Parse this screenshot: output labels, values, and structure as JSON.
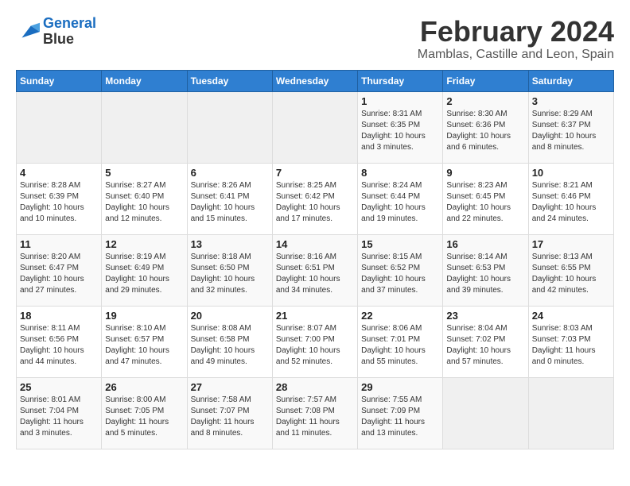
{
  "logo": {
    "line1": "General",
    "line2": "Blue"
  },
  "title": "February 2024",
  "location": "Mamblas, Castille and Leon, Spain",
  "days_of_week": [
    "Sunday",
    "Monday",
    "Tuesday",
    "Wednesday",
    "Thursday",
    "Friday",
    "Saturday"
  ],
  "weeks": [
    [
      {
        "num": "",
        "info": ""
      },
      {
        "num": "",
        "info": ""
      },
      {
        "num": "",
        "info": ""
      },
      {
        "num": "",
        "info": ""
      },
      {
        "num": "1",
        "info": "Sunrise: 8:31 AM\nSunset: 6:35 PM\nDaylight: 10 hours\nand 3 minutes."
      },
      {
        "num": "2",
        "info": "Sunrise: 8:30 AM\nSunset: 6:36 PM\nDaylight: 10 hours\nand 6 minutes."
      },
      {
        "num": "3",
        "info": "Sunrise: 8:29 AM\nSunset: 6:37 PM\nDaylight: 10 hours\nand 8 minutes."
      }
    ],
    [
      {
        "num": "4",
        "info": "Sunrise: 8:28 AM\nSunset: 6:39 PM\nDaylight: 10 hours\nand 10 minutes."
      },
      {
        "num": "5",
        "info": "Sunrise: 8:27 AM\nSunset: 6:40 PM\nDaylight: 10 hours\nand 12 minutes."
      },
      {
        "num": "6",
        "info": "Sunrise: 8:26 AM\nSunset: 6:41 PM\nDaylight: 10 hours\nand 15 minutes."
      },
      {
        "num": "7",
        "info": "Sunrise: 8:25 AM\nSunset: 6:42 PM\nDaylight: 10 hours\nand 17 minutes."
      },
      {
        "num": "8",
        "info": "Sunrise: 8:24 AM\nSunset: 6:44 PM\nDaylight: 10 hours\nand 19 minutes."
      },
      {
        "num": "9",
        "info": "Sunrise: 8:23 AM\nSunset: 6:45 PM\nDaylight: 10 hours\nand 22 minutes."
      },
      {
        "num": "10",
        "info": "Sunrise: 8:21 AM\nSunset: 6:46 PM\nDaylight: 10 hours\nand 24 minutes."
      }
    ],
    [
      {
        "num": "11",
        "info": "Sunrise: 8:20 AM\nSunset: 6:47 PM\nDaylight: 10 hours\nand 27 minutes."
      },
      {
        "num": "12",
        "info": "Sunrise: 8:19 AM\nSunset: 6:49 PM\nDaylight: 10 hours\nand 29 minutes."
      },
      {
        "num": "13",
        "info": "Sunrise: 8:18 AM\nSunset: 6:50 PM\nDaylight: 10 hours\nand 32 minutes."
      },
      {
        "num": "14",
        "info": "Sunrise: 8:16 AM\nSunset: 6:51 PM\nDaylight: 10 hours\nand 34 minutes."
      },
      {
        "num": "15",
        "info": "Sunrise: 8:15 AM\nSunset: 6:52 PM\nDaylight: 10 hours\nand 37 minutes."
      },
      {
        "num": "16",
        "info": "Sunrise: 8:14 AM\nSunset: 6:53 PM\nDaylight: 10 hours\nand 39 minutes."
      },
      {
        "num": "17",
        "info": "Sunrise: 8:13 AM\nSunset: 6:55 PM\nDaylight: 10 hours\nand 42 minutes."
      }
    ],
    [
      {
        "num": "18",
        "info": "Sunrise: 8:11 AM\nSunset: 6:56 PM\nDaylight: 10 hours\nand 44 minutes."
      },
      {
        "num": "19",
        "info": "Sunrise: 8:10 AM\nSunset: 6:57 PM\nDaylight: 10 hours\nand 47 minutes."
      },
      {
        "num": "20",
        "info": "Sunrise: 8:08 AM\nSunset: 6:58 PM\nDaylight: 10 hours\nand 49 minutes."
      },
      {
        "num": "21",
        "info": "Sunrise: 8:07 AM\nSunset: 7:00 PM\nDaylight: 10 hours\nand 52 minutes."
      },
      {
        "num": "22",
        "info": "Sunrise: 8:06 AM\nSunset: 7:01 PM\nDaylight: 10 hours\nand 55 minutes."
      },
      {
        "num": "23",
        "info": "Sunrise: 8:04 AM\nSunset: 7:02 PM\nDaylight: 10 hours\nand 57 minutes."
      },
      {
        "num": "24",
        "info": "Sunrise: 8:03 AM\nSunset: 7:03 PM\nDaylight: 11 hours\nand 0 minutes."
      }
    ],
    [
      {
        "num": "25",
        "info": "Sunrise: 8:01 AM\nSunset: 7:04 PM\nDaylight: 11 hours\nand 3 minutes."
      },
      {
        "num": "26",
        "info": "Sunrise: 8:00 AM\nSunset: 7:05 PM\nDaylight: 11 hours\nand 5 minutes."
      },
      {
        "num": "27",
        "info": "Sunrise: 7:58 AM\nSunset: 7:07 PM\nDaylight: 11 hours\nand 8 minutes."
      },
      {
        "num": "28",
        "info": "Sunrise: 7:57 AM\nSunset: 7:08 PM\nDaylight: 11 hours\nand 11 minutes."
      },
      {
        "num": "29",
        "info": "Sunrise: 7:55 AM\nSunset: 7:09 PM\nDaylight: 11 hours\nand 13 minutes."
      },
      {
        "num": "",
        "info": ""
      },
      {
        "num": "",
        "info": ""
      }
    ]
  ]
}
